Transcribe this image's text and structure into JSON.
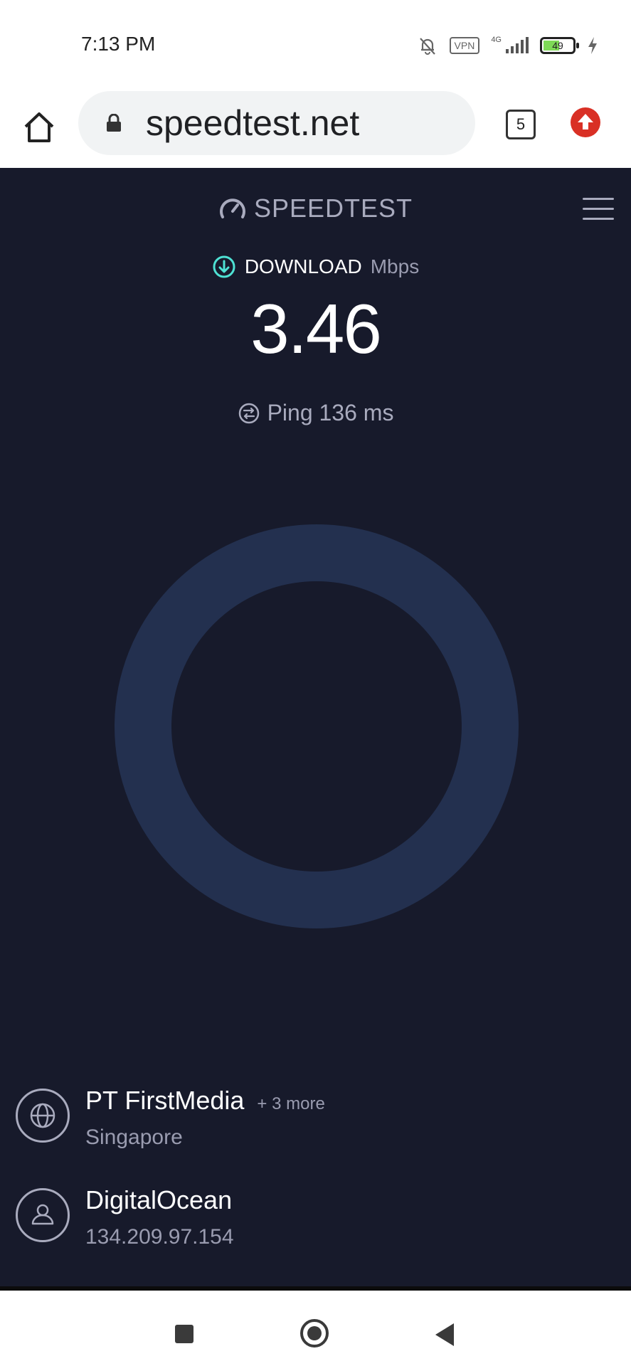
{
  "status_bar": {
    "time": "7:13 PM",
    "vpn_label": "VPN",
    "network_label": "4G",
    "battery_level": "49",
    "icons": [
      "bell-muted-icon",
      "vpn-icon",
      "signal-icon",
      "battery-icon",
      "charging-icon"
    ]
  },
  "browser": {
    "url": "speedtest.net",
    "tab_count": "5",
    "icons": [
      "home-icon",
      "lock-icon",
      "tabs-icon",
      "update-icon"
    ]
  },
  "app": {
    "brand": "SPEEDTEST",
    "download_label": "DOWNLOAD",
    "download_unit": "Mbps",
    "speed_value": "3.46",
    "ping_label": "Ping 136 ms",
    "gauge_color": "#23304f",
    "accent_color": "#4ee1d3",
    "background_color": "#171a2b",
    "isp": {
      "name": "PT FirstMedia",
      "more": "+ 3 more",
      "location": "Singapore"
    },
    "host": {
      "name": "DigitalOcean",
      "ip": "134.209.97.154"
    }
  },
  "nav_bar": {
    "icons": [
      "recents-icon",
      "home-icon",
      "back-icon"
    ]
  }
}
